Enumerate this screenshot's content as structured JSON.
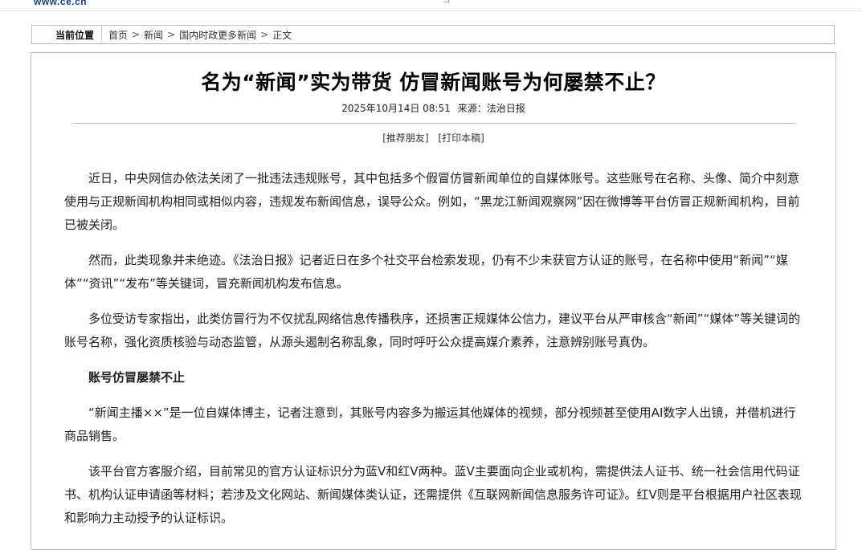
{
  "site": {
    "logo_text": "www.ce.cn"
  },
  "breadcrumb": {
    "label": "当前位置",
    "items": [
      "首页",
      "新闻",
      "国内时政更多新闻",
      "正文"
    ],
    "separator": ">"
  },
  "article": {
    "title": "名为“新闻”实为带货 仿冒新闻账号为何屡禁不止？",
    "date": "2025年10月14日 08:51",
    "source": "来源：法治日报",
    "tools": [
      "[推荐朋友]",
      "[打印本稿]"
    ],
    "paragraphs": [
      "近日，中央网信办依法关闭了一批违法违规账号，其中包括多个假冒仿冒新闻单位的自媒体账号。这些账号在名称、头像、简介中刻意使用与正规新闻机构相同或相似内容，违规发布新闻信息，误导公众。例如，“黑龙江新闻观察网”因在微博等平台仿冒正规新闻机构，目前已被关闭。",
      "然而，此类现象并未绝迹。《法治日报》记者近日在多个社交平台检索发现，仍有不少未获官方认证的账号，在名称中使用“新闻”“媒体”“资讯”“发布”等关键词，冒充新闻机构发布信息。",
      "多位受访专家指出，此类仿冒行为不仅扰乱网络信息传播秩序，还损害正规媒体公信力，建议平台从严审核含“新闻”“媒体”等关键词的账号名称，强化资质核验与动态监管，从源头遏制名称乱象，同时呼吁公众提高媒介素养，注意辨别账号真伪。",
      "账号仿冒屡禁不止",
      "“新闻主播××”是一位自媒体博主，记者注意到，其账号内容多为搬运其他媒体的视频，部分视频甚至使用AI数字人出镜，并借机进行商品销售。",
      "该平台官方客服介绍，目前常见的官方认证标识分为蓝V和红V两种。蓝V主要面向企业或机构，需提供法人证书、统一社会信用代码证书、机构认证申请函等材料；若涉及文化网站、新闻媒体类认证，还需提供《互联网新闻信息服务许可证》。红V则是平台根据用户社区表现和影响力主动授予的认证标识。"
    ]
  }
}
